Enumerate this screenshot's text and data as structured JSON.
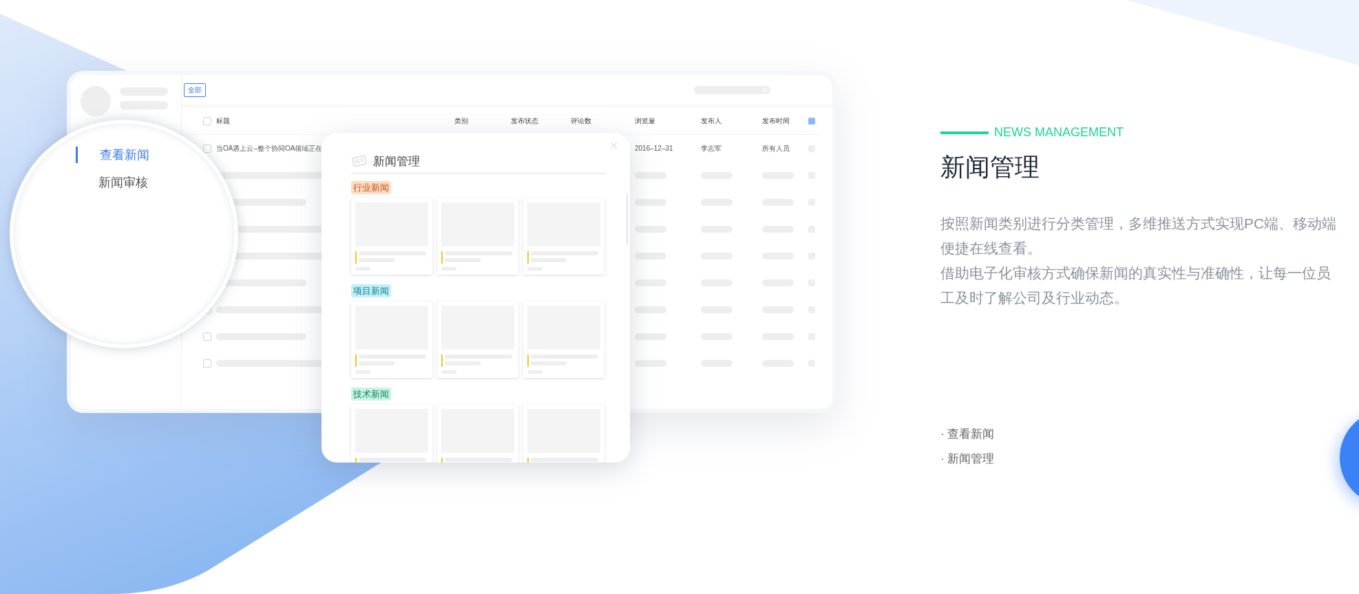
{
  "illustration": {
    "toolbar": {
      "filter_button": "全部"
    },
    "table": {
      "select_all": {
        "checked": false
      },
      "columns": [
        "标题",
        "类别",
        "发布状态",
        "评论数",
        "浏览量",
        "发布人",
        "发布时间"
      ],
      "rows": [
        {
          "checked": false,
          "title": "当OA遇上云–整个协同OA领域正在",
          "views": "2016–12–31",
          "publisher": "李志军",
          "published_at": "所有人员"
        }
      ],
      "placeholder_rows": [
        {
          "checked": false
        },
        {
          "checked": false
        },
        {
          "checked": false
        }
      ]
    },
    "magnifier": {
      "menu": [
        {
          "label": "查看新闻",
          "selected": true
        },
        {
          "label": "新闻审核",
          "selected": false
        }
      ]
    },
    "modal": {
      "title": "新闻管理",
      "sections": [
        {
          "tag": "行业新闻",
          "color": "#ffdcc4"
        },
        {
          "tag": "项目新闻",
          "color": "#c2f1f6"
        },
        {
          "tag": "技术新闻",
          "color": "#c6f4e5"
        }
      ]
    }
  },
  "feature": {
    "eyebrow": "NEWS MANAGEMENT",
    "title": "新闻管理",
    "paragraphs": [
      "按照新闻类别进行分类管理，多维推送方式实现PC端、移动端便捷在线查看。",
      "借助电子化审核方式确保新闻的真实性与准确性，让每一位员工及时了解公司及行业动态。"
    ],
    "links": [
      "· 查看新闻",
      "· 新闻管理"
    ]
  }
}
